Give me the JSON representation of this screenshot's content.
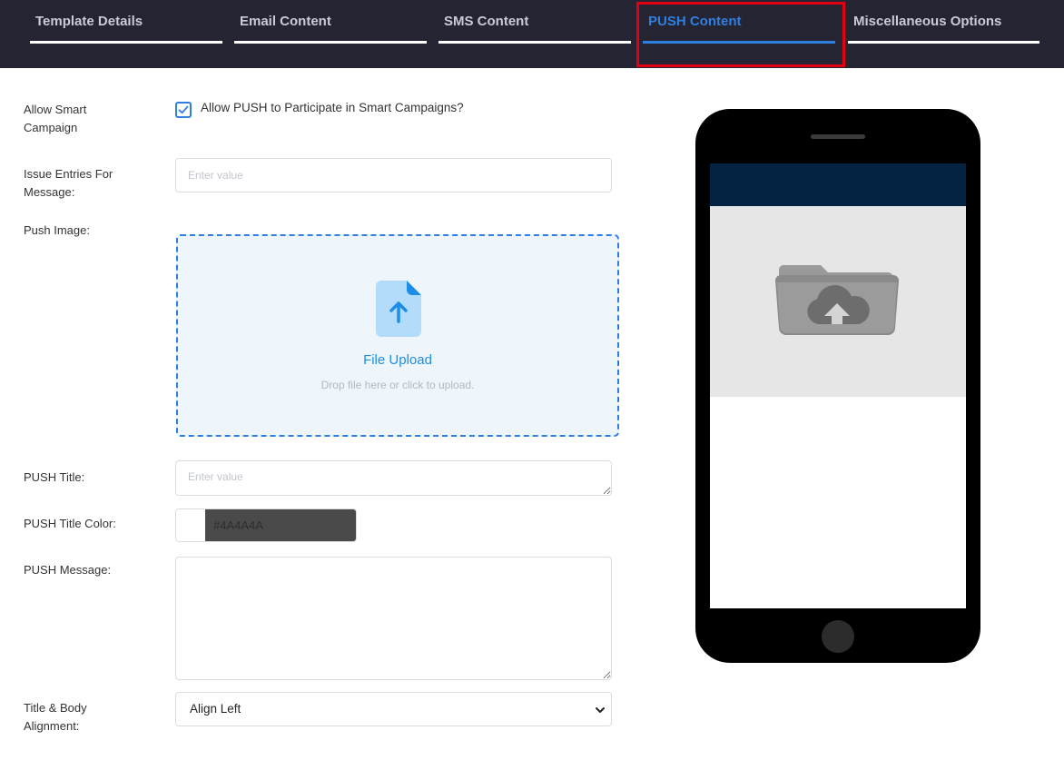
{
  "tabs": [
    {
      "label": "Template Details",
      "active": false
    },
    {
      "label": "Email Content",
      "active": false
    },
    {
      "label": "SMS Content",
      "active": false
    },
    {
      "label": "PUSH Content",
      "active": true
    },
    {
      "label": "Miscellaneous Options",
      "active": false
    }
  ],
  "form": {
    "allow_smart_campaign": {
      "label": "Allow Smart Campaign",
      "checkbox_text": "Allow PUSH to Participate in Smart Campaigns?",
      "checked": true
    },
    "issue_entries": {
      "label": "Issue Entries For Message:",
      "value": "",
      "placeholder": "Enter value"
    },
    "push_image": {
      "label": "Push Image:",
      "upload_title": "File Upload",
      "upload_hint": "Drop file here or click to upload."
    },
    "push_title": {
      "label": "PUSH Title:",
      "value": "",
      "placeholder": "Enter value"
    },
    "push_title_color": {
      "label": "PUSH Title Color:",
      "value": "#4A4A4A"
    },
    "push_message": {
      "label": "PUSH Message:",
      "value": ""
    },
    "alignment": {
      "label": "Title & Body Alignment:",
      "selected": "Align Left"
    }
  },
  "preview": {
    "header_color": "#042342",
    "image_placeholder_icon": "cloud-upload-folder-icon"
  },
  "colors": {
    "accent": "#2f7fe0",
    "tabbar_bg": "#242432",
    "highlight": "#e3000f"
  }
}
